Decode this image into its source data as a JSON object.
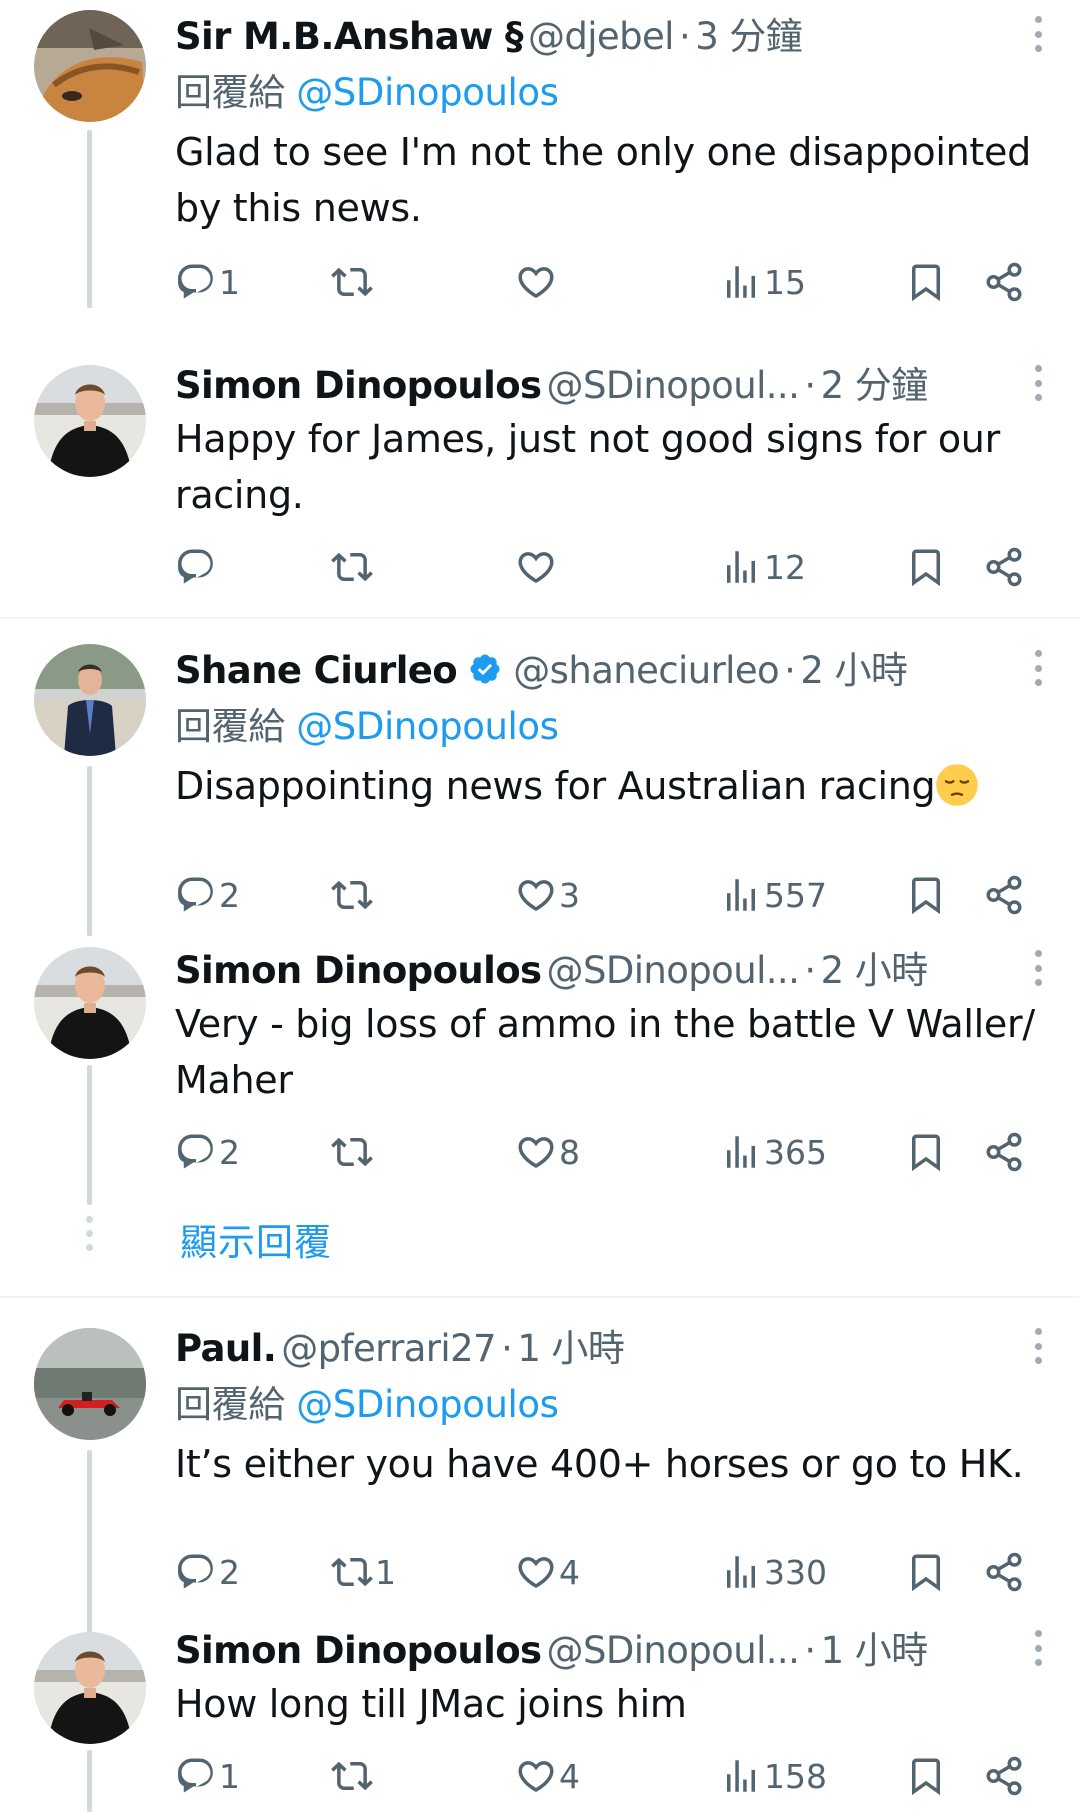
{
  "reply_prefix": "回覆給",
  "show_replies_label": "顯示回覆",
  "colors": {
    "accent": "#1d9bf0",
    "secondary": "#536471",
    "text": "#0f1419",
    "thread_line": "#cfd9de"
  },
  "tweets": [
    {
      "name": "Sir M.B.Anshaw §",
      "handle": "@djebel",
      "dot": "·",
      "time": "3 分鐘",
      "replying_to": "@SDinopoulos",
      "text": "Glad to see I'm not the only one disappointed by this news.",
      "replies": "1",
      "retweets": "",
      "likes": "",
      "views": "15",
      "avatar": "dog-avatar"
    },
    {
      "name": "Simon Dinopoulos",
      "handle": "@SDinopoul...",
      "dot": "·",
      "time": "2 分鐘",
      "text": "Happy for James, just not good signs for our racing.",
      "replies": "",
      "retweets": "",
      "likes": "",
      "views": "12",
      "avatar": "man-black-jacket-avatar"
    },
    {
      "name": "Shane Ciurleo",
      "verified": true,
      "handle": "@shaneciurleo",
      "dot": "·",
      "time": "2 小時",
      "replying_to": "@SDinopoulos",
      "text": "Disappointing news for Australian racing",
      "emoji": "pensive-face",
      "replies": "2",
      "retweets": "",
      "likes": "3",
      "views": "557",
      "avatar": "man-suit-avatar"
    },
    {
      "name": "Simon Dinopoulos",
      "handle": "@SDinopoul...",
      "dot": "·",
      "time": "2 小時",
      "text": "Very - big loss of ammo in the battle V Waller/ Maher",
      "replies": "2",
      "retweets": "",
      "likes": "8",
      "views": "365",
      "avatar": "man-black-jacket-avatar"
    },
    {
      "name": "Paul.",
      "handle": "@pferrari27",
      "dot": "·",
      "time": "1 小時",
      "replying_to": "@SDinopoulos",
      "text": "It’s either you have 400+ horses or go to HK.",
      "replies": "2",
      "retweets": "1",
      "likes": "4",
      "views": "330",
      "avatar": "racing-car-avatar"
    },
    {
      "name": "Simon Dinopoulos",
      "handle": "@SDinopoul...",
      "dot": "·",
      "time": "1 小時",
      "text": "How long till JMac joins him",
      "replies": "1",
      "retweets": "",
      "likes": "4",
      "views": "158",
      "avatar": "man-black-jacket-avatar"
    }
  ]
}
